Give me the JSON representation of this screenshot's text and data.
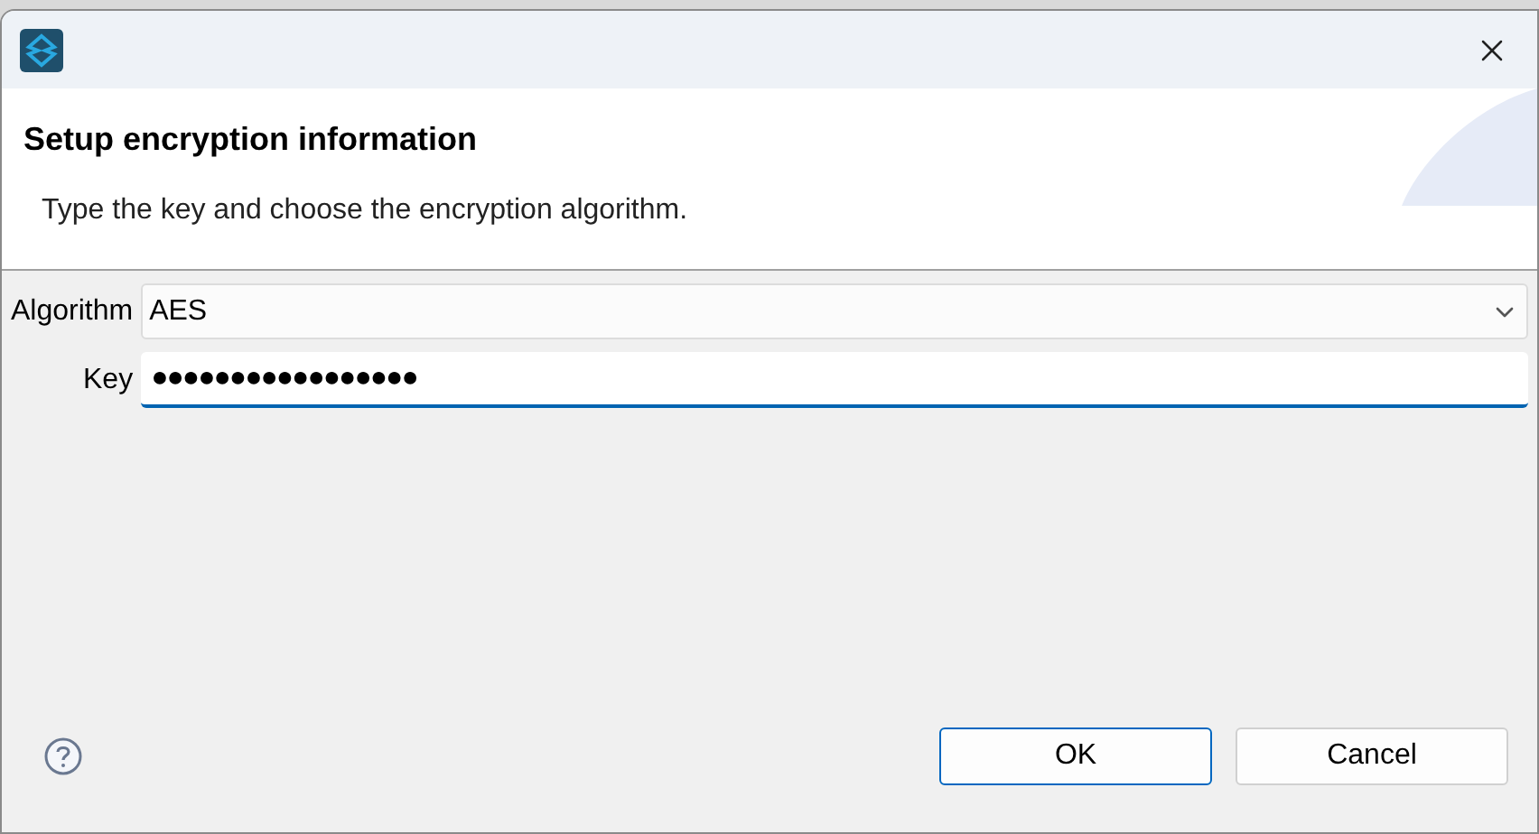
{
  "header": {
    "title": "Setup encryption information",
    "message": "Type the key and choose the encryption algorithm."
  },
  "form": {
    "algorithm": {
      "label": "Algorithm",
      "value": "AES"
    },
    "key": {
      "label": "Key",
      "value": "●●●●●●●●●●●●●●●●●",
      "focused": true
    }
  },
  "buttons": [
    {
      "label": "OK",
      "default": true
    },
    {
      "label": "Cancel",
      "default": false
    }
  ]
}
